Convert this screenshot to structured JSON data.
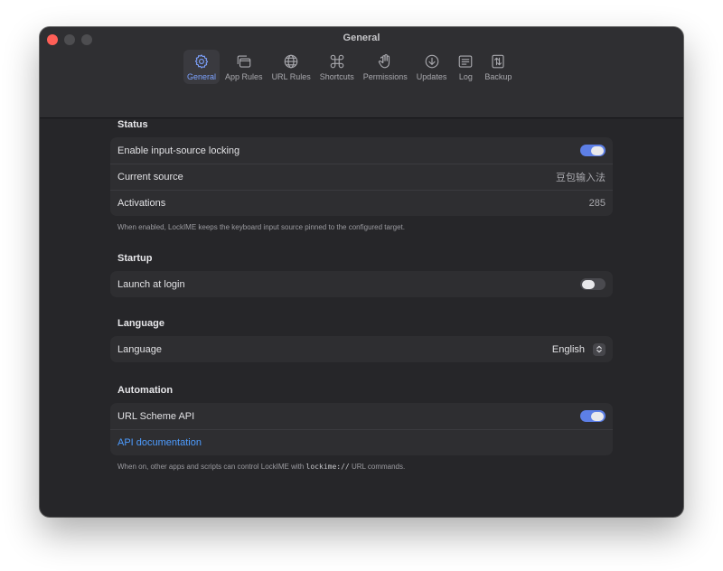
{
  "window": {
    "title": "General"
  },
  "toolbar": {
    "tabs": [
      {
        "label": "General",
        "icon": "gear-icon",
        "active": true
      },
      {
        "label": "App Rules",
        "icon": "app-windows-icon"
      },
      {
        "label": "URL Rules",
        "icon": "globe-icon"
      },
      {
        "label": "Shortcuts",
        "icon": "command-icon"
      },
      {
        "label": "Permissions",
        "icon": "hand-icon"
      },
      {
        "label": "Updates",
        "icon": "download-icon"
      },
      {
        "label": "Log",
        "icon": "list-icon"
      },
      {
        "label": "Backup",
        "icon": "backup-icon"
      }
    ]
  },
  "status": {
    "title": "Status",
    "enable_label": "Enable input-source locking",
    "enable_on": true,
    "current_source_label": "Current source",
    "current_source_value": "豆包输入法",
    "activations_label": "Activations",
    "activations_value": "285",
    "note": "When enabled, LockIME keeps the keyboard input source pinned to the configured target."
  },
  "startup": {
    "title": "Startup",
    "launch_label": "Launch at login",
    "launch_on": false
  },
  "language": {
    "title": "Language",
    "label": "Language",
    "value": "English"
  },
  "automation": {
    "title": "Automation",
    "url_scheme_label": "URL Scheme API",
    "url_scheme_on": true,
    "api_doc_link": "API documentation",
    "note_prefix": "When on, other apps and scripts can control LockIME with ",
    "note_code": "lockime://",
    "note_suffix": " URL commands."
  },
  "colors": {
    "accent": "#5d7fe6",
    "link": "#4d9cff",
    "active_tab": "#7da2ff",
    "close_button": "#ff5f57"
  }
}
